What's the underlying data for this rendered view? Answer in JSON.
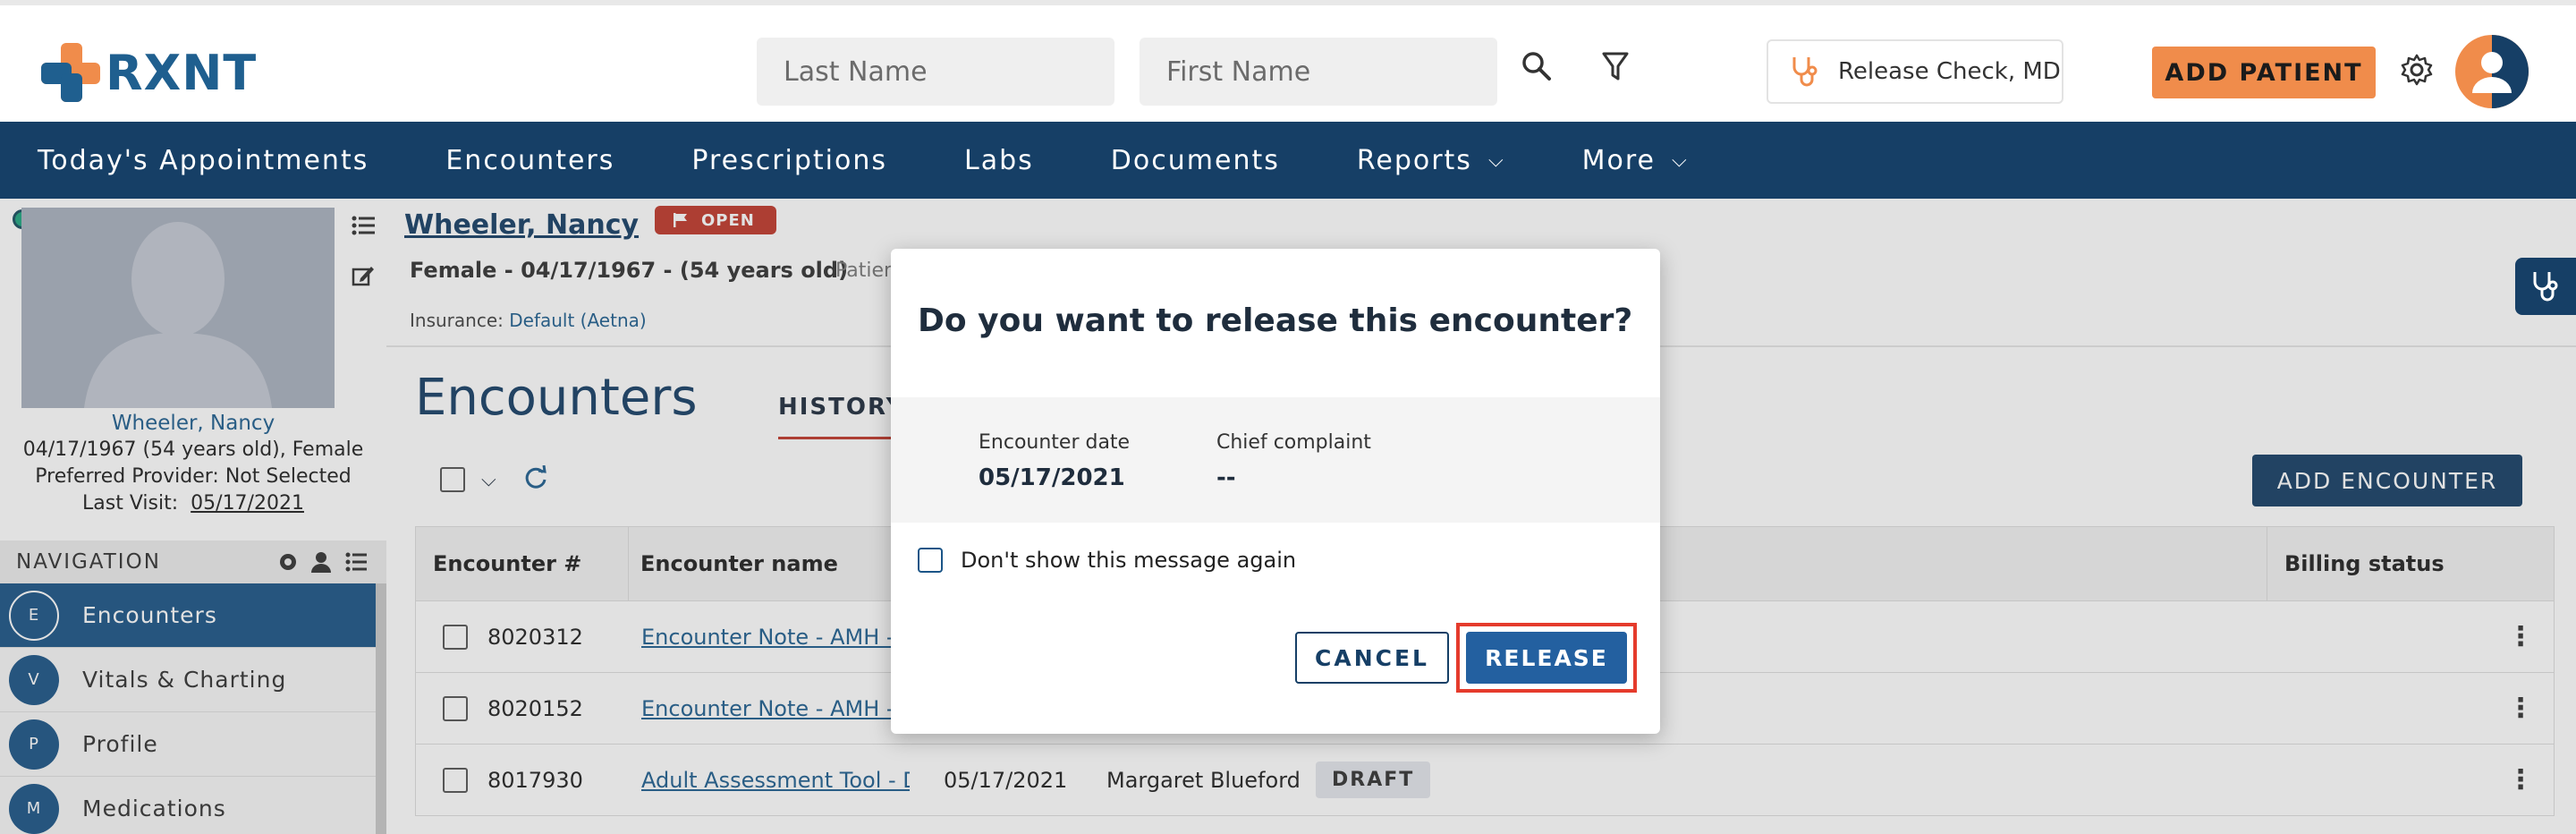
{
  "app": {
    "logo_text": "RXNT",
    "brand_orange": "#f08c4b",
    "brand_navy": "#163f66"
  },
  "header": {
    "last_name_placeholder": "Last Name",
    "first_name_placeholder": "First Name",
    "provider": "Release Check, MD",
    "add_patient_label": "ADD PATIENT"
  },
  "nav": {
    "items": [
      {
        "label": "Today's Appointments"
      },
      {
        "label": "Encounters"
      },
      {
        "label": "Prescriptions"
      },
      {
        "label": "Labs"
      },
      {
        "label": "Documents"
      },
      {
        "label": "Reports",
        "dropdown": true
      },
      {
        "label": "More",
        "dropdown": true
      }
    ]
  },
  "patient_card": {
    "name": "Wheeler, Nancy",
    "demographics": "04/17/1967 (54 years old), Female",
    "preferred_provider": "Preferred Provider: Not Selected",
    "last_visit_label": "Last Visit:",
    "last_visit_date": "05/17/2021"
  },
  "left_nav": {
    "title": "NAVIGATION",
    "items": [
      {
        "initial": "E",
        "label": "Encounters",
        "active": true
      },
      {
        "initial": "V",
        "label": "Vitals & Charting"
      },
      {
        "initial": "P",
        "label": "Profile"
      },
      {
        "initial": "M",
        "label": "Medications"
      }
    ]
  },
  "patient_header": {
    "name": "Wheeler, Nancy",
    "status": "OPEN",
    "demographics": "Female - 04/17/1967 - (54 years old)",
    "patient_label": "Patien",
    "insurance_label": "Insurance:",
    "insurance_value": "Default (Aetna)"
  },
  "encounters": {
    "title": "Encounters",
    "tab": "HISTORY",
    "add_label": "ADD ENCOUNTER",
    "columns": {
      "number": "Encounter #",
      "name": "Encounter name",
      "billing": "Billing status"
    },
    "rows": [
      {
        "number": "8020312",
        "name": "Encounter Note - AMH - Sm",
        "date": "",
        "provider": "",
        "status": ""
      },
      {
        "number": "8020152",
        "name": "Encounter Note - AMH - Sm",
        "date": "",
        "provider": "",
        "status": ""
      },
      {
        "number": "8017930",
        "name": "Adult Assessment Tool - Du",
        "date": "05/17/2021",
        "provider": "Margaret Blueford",
        "status": "DRAFT"
      }
    ]
  },
  "modal": {
    "title": "Do you want to release this encounter?",
    "encounter_date_label": "Encounter date",
    "encounter_date": "05/17/2021",
    "chief_complaint_label": "Chief complaint",
    "chief_complaint": "--",
    "dont_show_label": "Don't show this message again",
    "cancel_label": "CANCEL",
    "release_label": "RELEASE"
  }
}
